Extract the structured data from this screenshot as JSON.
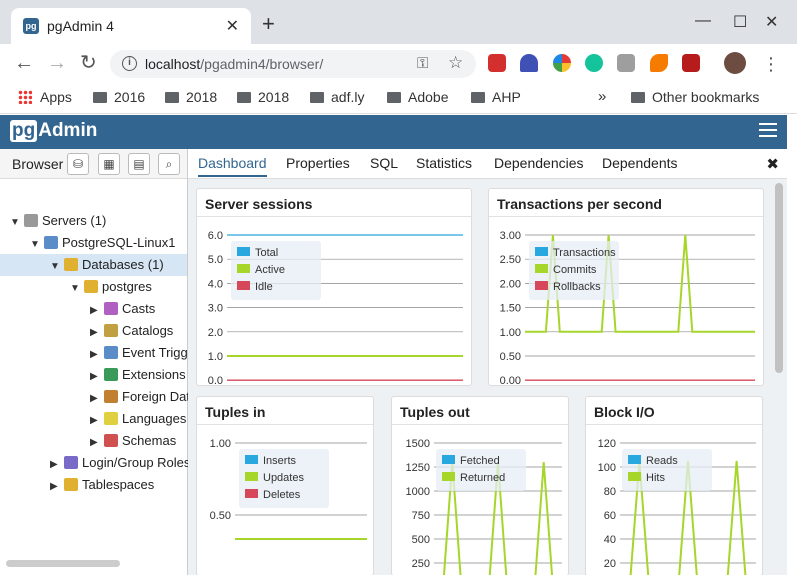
{
  "window": {
    "tab_title": "pgAdmin 4",
    "favicon": "pg",
    "close_tab": "✕",
    "new_tab": "+",
    "minimize": "—",
    "maximize": "☐",
    "close": "✕"
  },
  "toolbar": {
    "back": "←",
    "forward": "→",
    "reload": "↻",
    "url_host": "localhost",
    "url_path": "/pgadmin4/browser/",
    "info_icon": "i",
    "key_icon": "⚿",
    "star_icon": "☆",
    "menu": "⋮"
  },
  "bookmarks": {
    "apps": "Apps",
    "items": [
      "2016",
      "2018",
      "2018",
      "adf.ly",
      "Adobe",
      "AHP"
    ],
    "more": "»",
    "other": "Other bookmarks"
  },
  "pgadmin": {
    "logo_pg": "pg",
    "logo_rest": "Admin"
  },
  "browser": {
    "label": "Browser",
    "tree": [
      {
        "label": "Servers (1)",
        "arrow": "▼"
      },
      {
        "label": "PostgreSQL-Linux1",
        "arrow": "▼"
      },
      {
        "label": "Databases (1)",
        "arrow": "▼"
      },
      {
        "label": "postgres",
        "arrow": "▼"
      },
      {
        "label": "Casts",
        "arrow": "▶"
      },
      {
        "label": "Catalogs",
        "arrow": "▶"
      },
      {
        "label": "Event Trigg",
        "arrow": "▶"
      },
      {
        "label": "Extensions",
        "arrow": "▶"
      },
      {
        "label": "Foreign Dat",
        "arrow": "▶"
      },
      {
        "label": "Languages",
        "arrow": "▶"
      },
      {
        "label": "Schemas",
        "arrow": "▶"
      },
      {
        "label": "Login/Group Roles",
        "arrow": "▶"
      },
      {
        "label": "Tablespaces",
        "arrow": "▶"
      }
    ]
  },
  "tabs": [
    "Dashboard",
    "Properties",
    "SQL",
    "Statistics",
    "Dependencies",
    "Dependents"
  ],
  "close_tab": "✖",
  "colors": {
    "blue": "#29a8e0",
    "green": "#a6d62a",
    "red": "#d6475a",
    "header": "#326690"
  },
  "chart_data": [
    {
      "type": "line",
      "title": "Server sessions",
      "yticks": [
        "6.0",
        "5.0",
        "4.0",
        "3.0",
        "2.0",
        "1.0",
        "0.0"
      ],
      "ylim": [
        0,
        6
      ],
      "series": [
        {
          "name": "Total",
          "values": [
            6,
            6,
            6,
            6,
            6,
            6,
            6,
            6,
            6,
            6
          ]
        },
        {
          "name": "Active",
          "values": [
            1,
            1,
            1,
            1,
            1,
            1,
            1,
            1,
            1,
            1
          ]
        },
        {
          "name": "Idle",
          "values": [
            0,
            0,
            0,
            0,
            0,
            0,
            0,
            0,
            0,
            0
          ]
        }
      ]
    },
    {
      "type": "line",
      "title": "Transactions per second",
      "yticks": [
        "3.00",
        "2.50",
        "2.00",
        "1.50",
        "1.00",
        "0.50",
        "0.00"
      ],
      "ylim": [
        0,
        3
      ],
      "series": [
        {
          "name": "Transactions",
          "values": [
            1,
            1,
            1,
            1,
            3,
            1,
            1,
            1,
            1,
            1,
            1,
            1,
            3,
            1,
            1,
            1,
            1,
            1,
            1,
            1,
            1,
            1,
            1,
            3,
            1,
            1,
            1,
            1,
            1,
            1,
            1,
            1,
            1,
            1
          ]
        },
        {
          "name": "Commits",
          "values": [
            1,
            1,
            1,
            1,
            3,
            1,
            1,
            1,
            1,
            1,
            1,
            1,
            3,
            1,
            1,
            1,
            1,
            1,
            1,
            1,
            1,
            1,
            1,
            3,
            1,
            1,
            1,
            1,
            1,
            1,
            1,
            1,
            1,
            1
          ]
        },
        {
          "name": "Rollbacks",
          "values": [
            0,
            0,
            0,
            0,
            0,
            0,
            0,
            0,
            0,
            0
          ]
        }
      ]
    },
    {
      "type": "line",
      "title": "Tuples in",
      "yticks": [
        "1.00",
        "0.50"
      ],
      "ylim": [
        0,
        1
      ],
      "series": [
        {
          "name": "Inserts",
          "values": [
            0,
            0,
            0
          ]
        },
        {
          "name": "Updates",
          "values": [
            0,
            0,
            0
          ]
        },
        {
          "name": "Deletes",
          "values": [
            0,
            0,
            0
          ]
        }
      ]
    },
    {
      "type": "line",
      "title": "Tuples out",
      "yticks": [
        "1500",
        "1250",
        "1000",
        "750",
        "500",
        "250"
      ],
      "ylim": [
        0,
        1500
      ],
      "series": [
        {
          "name": "Fetched",
          "values": [
            0,
            0,
            0,
            0,
            0
          ]
        },
        {
          "name": "Returned",
          "values": [
            0,
            0,
            1300,
            0,
            0,
            0,
            0,
            1300,
            0,
            0,
            0,
            0,
            1300,
            0,
            0
          ]
        }
      ]
    },
    {
      "type": "line",
      "title": "Block I/O",
      "yticks": [
        "120",
        "100",
        "80",
        "60",
        "40",
        "20"
      ],
      "ylim": [
        0,
        120
      ],
      "series": [
        {
          "name": "Reads",
          "values": [
            0,
            0,
            0
          ]
        },
        {
          "name": "Hits",
          "values": [
            0,
            0,
            105,
            0,
            0,
            0,
            0,
            105,
            0,
            0,
            0,
            0,
            105,
            0,
            0
          ]
        }
      ]
    }
  ]
}
